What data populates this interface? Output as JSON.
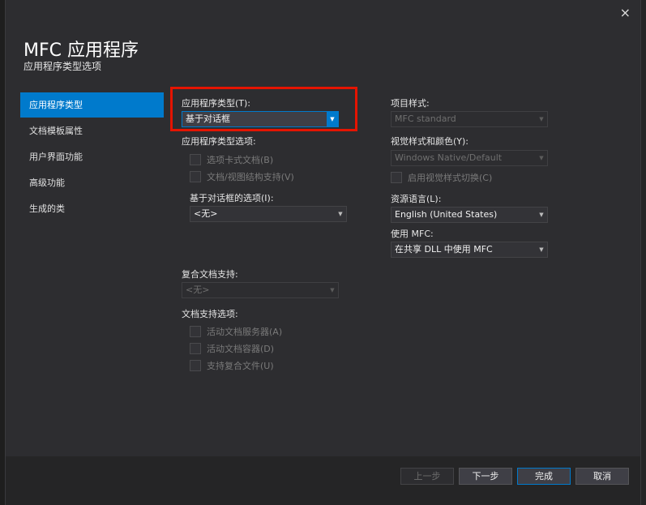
{
  "dialog": {
    "title": "MFC 应用程序",
    "subtitle": "应用程序类型选项",
    "close_glyph": "×"
  },
  "nav": {
    "items": [
      {
        "label": "应用程序类型",
        "active": true
      },
      {
        "label": "文档模板属性",
        "active": false
      },
      {
        "label": "用户界面功能",
        "active": false
      },
      {
        "label": "高级功能",
        "active": false
      },
      {
        "label": "生成的类",
        "active": false
      }
    ]
  },
  "app_type": {
    "label": "应用程序类型(T):",
    "value": "基于对话框",
    "options_label": "应用程序类型选项:",
    "tabbed_docs": "选项卡式文档(B)",
    "doc_view": "文档/视图结构支持(V)",
    "dialog_options_label": "基于对话框的选项(I):",
    "dialog_options_value": "<无>"
  },
  "compound": {
    "label": "复合文档支持:",
    "value": "<无>"
  },
  "doc_support": {
    "label": "文档支持选项:",
    "active_server": "活动文档服务器(A)",
    "active_container": "活动文档容器(D)",
    "compound_files": "支持复合文件(U)"
  },
  "right": {
    "project_style_label": "项目样式:",
    "project_style_value": "MFC standard",
    "visual_style_label": "视觉样式和颜色(Y):",
    "visual_style_value": "Windows Native/Default",
    "enable_visual_switch": "启用视觉样式切换(C)",
    "resource_lang_label": "资源语言(L):",
    "resource_lang_value": "English (United States)",
    "use_mfc_label": "使用 MFC:",
    "use_mfc_value": "在共享 DLL 中使用 MFC"
  },
  "buttons": {
    "prev": "上一步",
    "next": "下一步",
    "finish": "完成",
    "cancel": "取消"
  },
  "colors": {
    "accent": "#007acc",
    "highlight_border": "#e51400",
    "background": "#2d2d30"
  }
}
